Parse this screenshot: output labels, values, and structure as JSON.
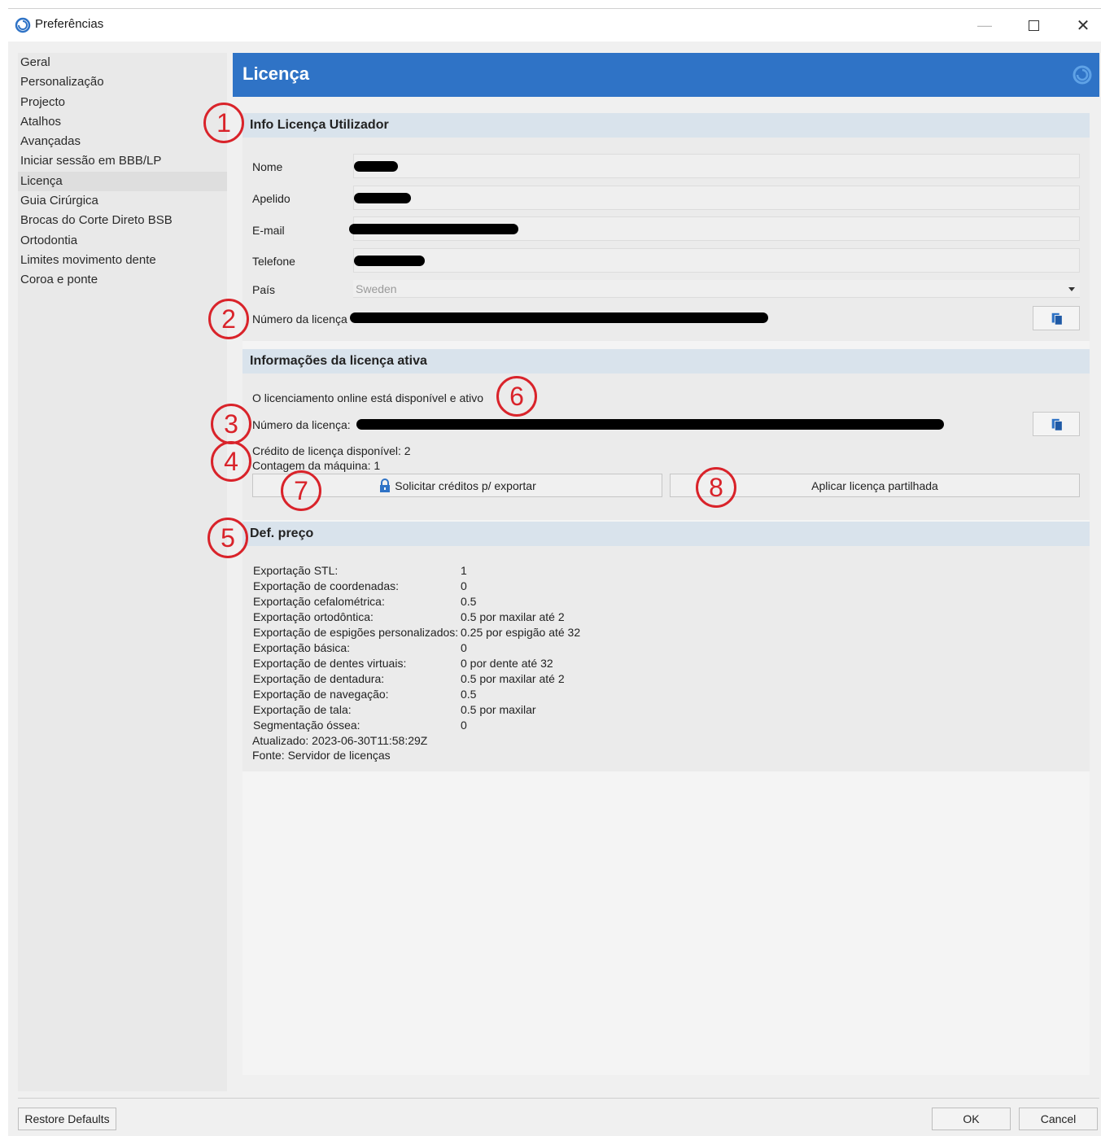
{
  "window": {
    "title": "Preferências",
    "app_icon": "spiral-logo-icon",
    "controls": {
      "minimize": "minimize-icon",
      "maximize": "maximize-icon",
      "close": "close-icon"
    }
  },
  "sidebar": {
    "items": [
      {
        "label": "Geral"
      },
      {
        "label": "Personalização"
      },
      {
        "label": "Projecto"
      },
      {
        "label": "Atalhos"
      },
      {
        "label": "Avançadas"
      },
      {
        "label": "Iniciar sessão em BBB/LP"
      },
      {
        "label": "Licença",
        "active": true
      },
      {
        "label": "Guia Cirúrgica"
      },
      {
        "label": "Brocas do Corte Direto BSB"
      },
      {
        "label": "Ortodontia"
      },
      {
        "label": "Limites movimento dente"
      },
      {
        "label": "Coroa e ponte"
      }
    ]
  },
  "banner": {
    "title": "Licença",
    "color": "#2f73c6"
  },
  "user_info": {
    "heading": "Info Licença Utilizador",
    "name_label": "Nome",
    "surname_label": "Apelido",
    "email_label": "E-mail",
    "phone_label": "Telefone",
    "country_label": "País",
    "country_value": "Sweden",
    "license_label": "Número da licença"
  },
  "active_license": {
    "heading": "Informações da licença ativa",
    "status": "O licenciamento online está disponível e ativo",
    "license_label": "Número da licença:",
    "credit": "Crédito de licença disponível: 2",
    "machine_count": "Contagem da máquina: 1",
    "request_button": "Solicitar créditos p/ exportar",
    "apply_button": "Aplicar licença partilhada"
  },
  "pricing": {
    "heading": "Def. preço",
    "rows": [
      {
        "label": "Exportação STL:",
        "value": "1"
      },
      {
        "label": "Exportação de coordenadas:",
        "value": "0"
      },
      {
        "label": "Exportação cefalométrica:",
        "value": "0.5"
      },
      {
        "label": "Exportação ortodôntica:",
        "value": "0.5 por maxilar até 2"
      },
      {
        "label": "Exportação de espigões personalizados:",
        "value": "0.25 por espigão até 32"
      },
      {
        "label": "Exportação básica:",
        "value": "0"
      },
      {
        "label": "Exportação de dentes virtuais:",
        "value": "0 por dente até 32"
      },
      {
        "label": "Exportação de dentadura:",
        "value": "0.5 por maxilar até 2"
      },
      {
        "label": "Exportação de navegação:",
        "value": "0.5"
      },
      {
        "label": "Exportação de tala:",
        "value": "0.5 por maxilar"
      },
      {
        "label": "Segmentação óssea:",
        "value": "0"
      }
    ],
    "updated": "Atualizado: 2023-06-30T11:58:29Z",
    "source": "Fonte: Servidor de licenças"
  },
  "markers": [
    "1",
    "2",
    "3",
    "4",
    "5",
    "6",
    "7",
    "8"
  ],
  "footer": {
    "restore": "Restore Defaults",
    "ok": "OK",
    "cancel": "Cancel"
  },
  "colors": {
    "marker": "#d9232a",
    "section_header": "#d9e3ec"
  }
}
